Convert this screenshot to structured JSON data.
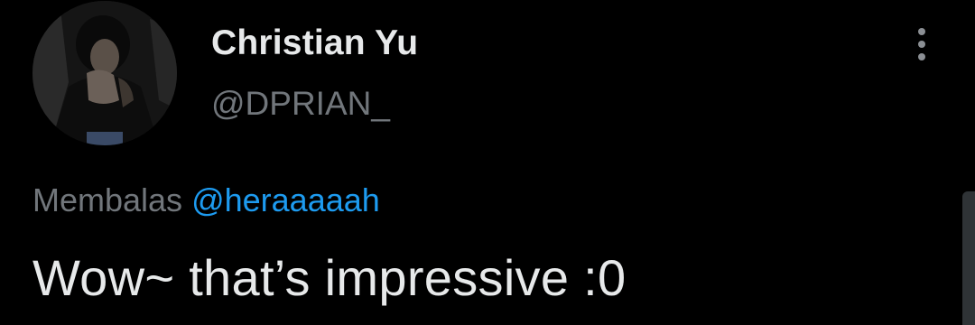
{
  "tweet": {
    "author": {
      "display_name": "Christian Yu",
      "handle": "@DPRIAN_",
      "avatar_icon": "profile-photo"
    },
    "reply": {
      "prefix": "Membalas",
      "mention": "@heraaaaah"
    },
    "text": "Wow~ that’s impressive :0",
    "menu_icon": "vertical-ellipsis-icon"
  },
  "colors": {
    "background": "#000000",
    "primary_text": "#e7e9ea",
    "secondary_text": "#71767b",
    "mention": "#1d9bf0"
  }
}
